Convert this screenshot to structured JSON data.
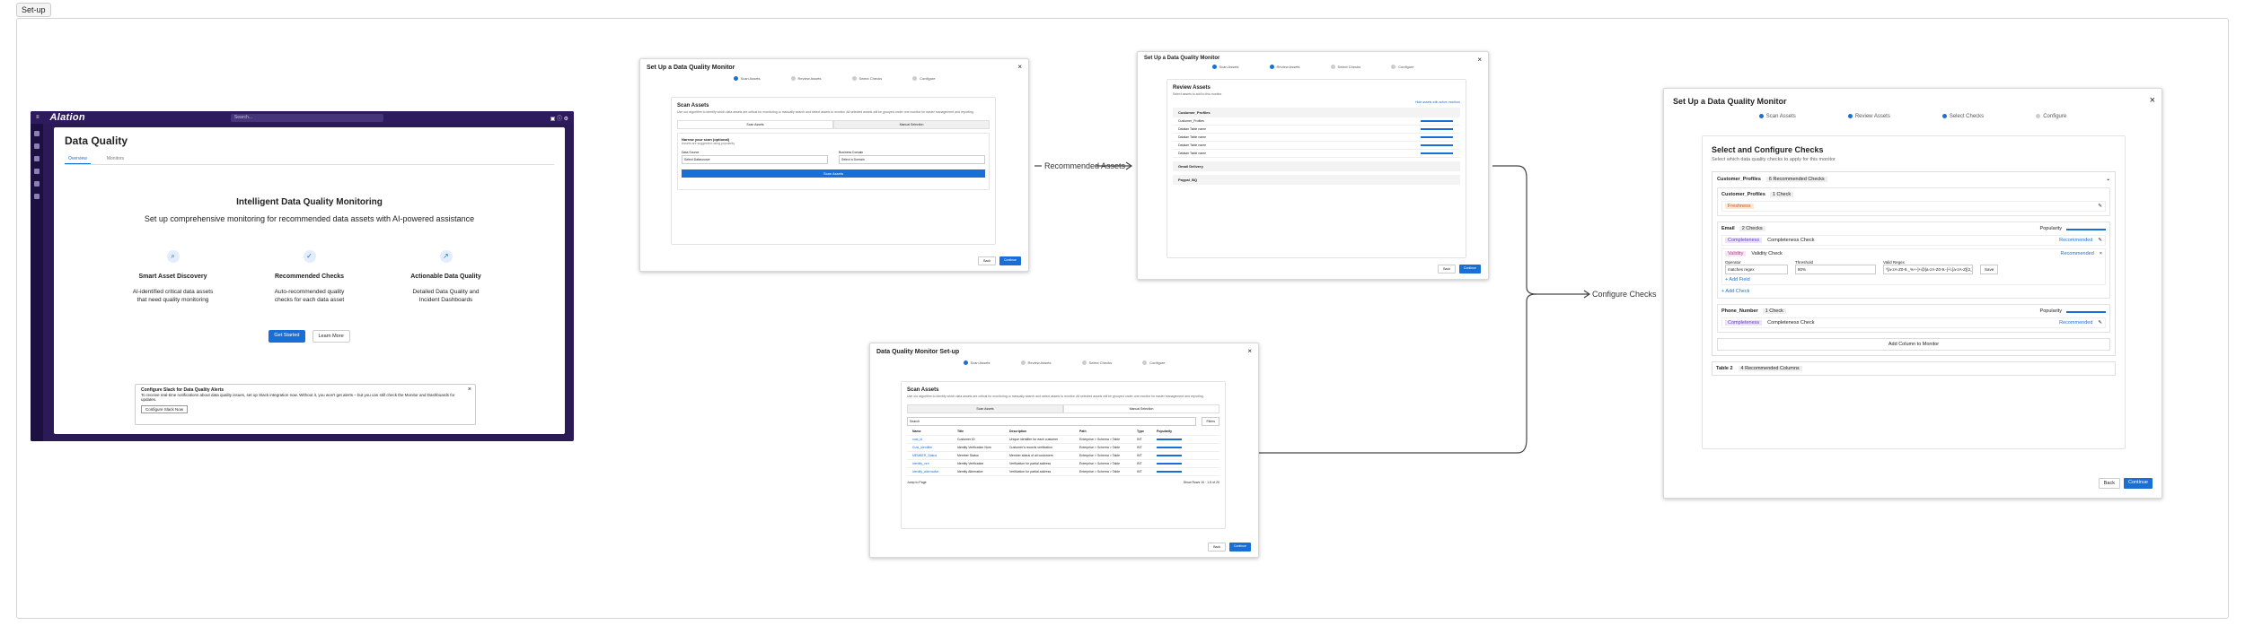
{
  "canvas": {
    "label": "Set-up"
  },
  "arrows": {
    "recommended": "Recommended Assets",
    "configure": "Configure Checks"
  },
  "screen1": {
    "logo": "Alation",
    "search": "Search...",
    "title": "Data Quality",
    "tabs": [
      "Overview",
      "Monitors"
    ],
    "heading": "Intelligent Data Quality Monitoring",
    "subheading": "Set up comprehensive monitoring for recommended data assets with AI-powered assistance",
    "features": [
      {
        "icon": "search-icon",
        "title": "Smart Asset Discovery",
        "desc": "AI-identified critical data assets that need quality monitoring"
      },
      {
        "icon": "check-circle-icon",
        "title": "Recommended Checks",
        "desc": "Auto-recommended quality checks for each data asset"
      },
      {
        "icon": "trend-icon",
        "title": "Actionable Data Quality",
        "desc": "Detailed Data Quality and Incident Dashboards"
      }
    ],
    "get_started": "Get Started",
    "learn_more": "Learn More",
    "alert": {
      "title": "Configure Slack for Data Quality Alerts",
      "body": "To receive real-time notifications about data quality issues, set up Slack integration now. Without it, you won't get alerts – but you can still check the Monitor and Dashboards for updates.",
      "button": "Configure Slack Now"
    }
  },
  "modal1": {
    "title": "Set Up a Data Quality Monitor",
    "steps": [
      "Scan Assets",
      "Review Assets",
      "Select Checks",
      "Configure"
    ],
    "heading": "Scan Assets",
    "desc": "Use our algorithm to identify which data assets are critical for monitoring or manually search and select assets to monitor. All selected assets will be grouped under one monitor for easier management and reporting.",
    "seg": [
      "Scan Assets",
      "Manual Selection"
    ],
    "narrow": "Narrow your scan (optional)",
    "narrow_sub": "Assets are suggested using popularity",
    "f1": "Data Source",
    "f1v": "Select Datasource",
    "f2": "Business Domain",
    "f2v": "Select a Domain",
    "scan": "Scan Assets",
    "back": "Back",
    "continue": "Continue"
  },
  "modal2": {
    "title": "Set Up a Data Quality Monitor",
    "steps": [
      "Scan Assets",
      "Review Assets",
      "Select Checks",
      "Configure"
    ],
    "heading": "Review Assets",
    "desc": "Select assets to add to this monitor",
    "toolbar": "Hide assets with active monitors",
    "sort": "Popularity",
    "rows": [
      "Customer_Profiles",
      "Datalan Table name",
      "Datalan Table name",
      "Datalan Table name",
      "Datalan Table name",
      "Datalan Table name"
    ],
    "group2": "Gmail Delivery",
    "group3": "Paypal_BQ",
    "back": "Back",
    "continue": "Continue"
  },
  "modal3": {
    "title": "Data Quality Monitor Set-up",
    "steps": [
      "Scan Assets",
      "Review Assets",
      "Select Checks",
      "Configure"
    ],
    "heading": "Scan Assets",
    "desc": "Use our algorithm to identify which data assets are critical for monitoring or manually search and select assets to monitor. All selected assets will be grouped under one monitor for easier management and reporting.",
    "seg": [
      "Scan Assets",
      "Manual Selection"
    ],
    "search": "Search",
    "filters": "Filters",
    "cols": [
      "Name",
      "Title",
      "Description",
      "Path",
      "Type",
      "Popularity"
    ],
    "rows": [
      [
        "cust_id",
        "Customer ID",
        "Unique identifier for each customer",
        "Enterprise > Schema > Table",
        "INT"
      ],
      [
        "Cust_identifier",
        "Identity Verification Num",
        "Customer's records verification",
        "Enterprise > Schema > Table",
        "INT"
      ],
      [
        "MEMBER_Status",
        "Member Status",
        "Member status of all customers",
        "Enterprise > Schema > Table",
        "INT"
      ],
      [
        "identity_veri",
        "Identity Verification",
        "Verification for partial address",
        "Enterprise > Schema > Table",
        "INT"
      ],
      [
        "identity_alternative",
        "Identity Alternative",
        "Verification for partial address",
        "Enterprise > Schema > Table",
        "INT"
      ]
    ],
    "jump": "Jump to Page",
    "pager": "Show Rows 10 · 1-5 of 20",
    "back": "Back",
    "continue": "Continue"
  },
  "modal4": {
    "title": "Set Up a Data Quality Monitor",
    "steps": [
      "Scan Assets",
      "Review Assets",
      "Select Checks",
      "Configure"
    ],
    "heading": "Select and Configure Checks",
    "desc": "Select which data quality checks to apply for this monitor",
    "group": "Customer_Profiles",
    "group_badge": "6 Recommended Checks",
    "sub1": "Customer_Profiles",
    "sub1_badge": "1 Check",
    "sub1_tag": "Freshness",
    "sub2": "Email",
    "sub2_badge": "2 Checks",
    "popularity": "Popularity",
    "c1_tag": "Completeness",
    "c1": "Completeness Check",
    "rec": "Recommended",
    "c2_tag": "Validity",
    "c2": "Validity Check",
    "op": "Operator",
    "op_v": "matches regex",
    "thr": "Threshold",
    "thr_v": "80%",
    "regex": "Valid Regex",
    "regex_v": "^[a-zA-Z0-9._%+-]+@[a-zA-Z0-9.-]+\\.[a-zA-Z]{2,}$",
    "save": "Save",
    "add_field": "+ Add Field",
    "add_check": "+ Add Check",
    "sub3": "Phone_Number",
    "sub3_badge": "1 Check",
    "c3_tag": "Completeness",
    "c3": "Completeness Check",
    "add_col": "Add Column to Monitor",
    "group2": "Table 2",
    "group2_badge": "4 Recommended Columns",
    "back": "Back",
    "continue": "Continue"
  }
}
